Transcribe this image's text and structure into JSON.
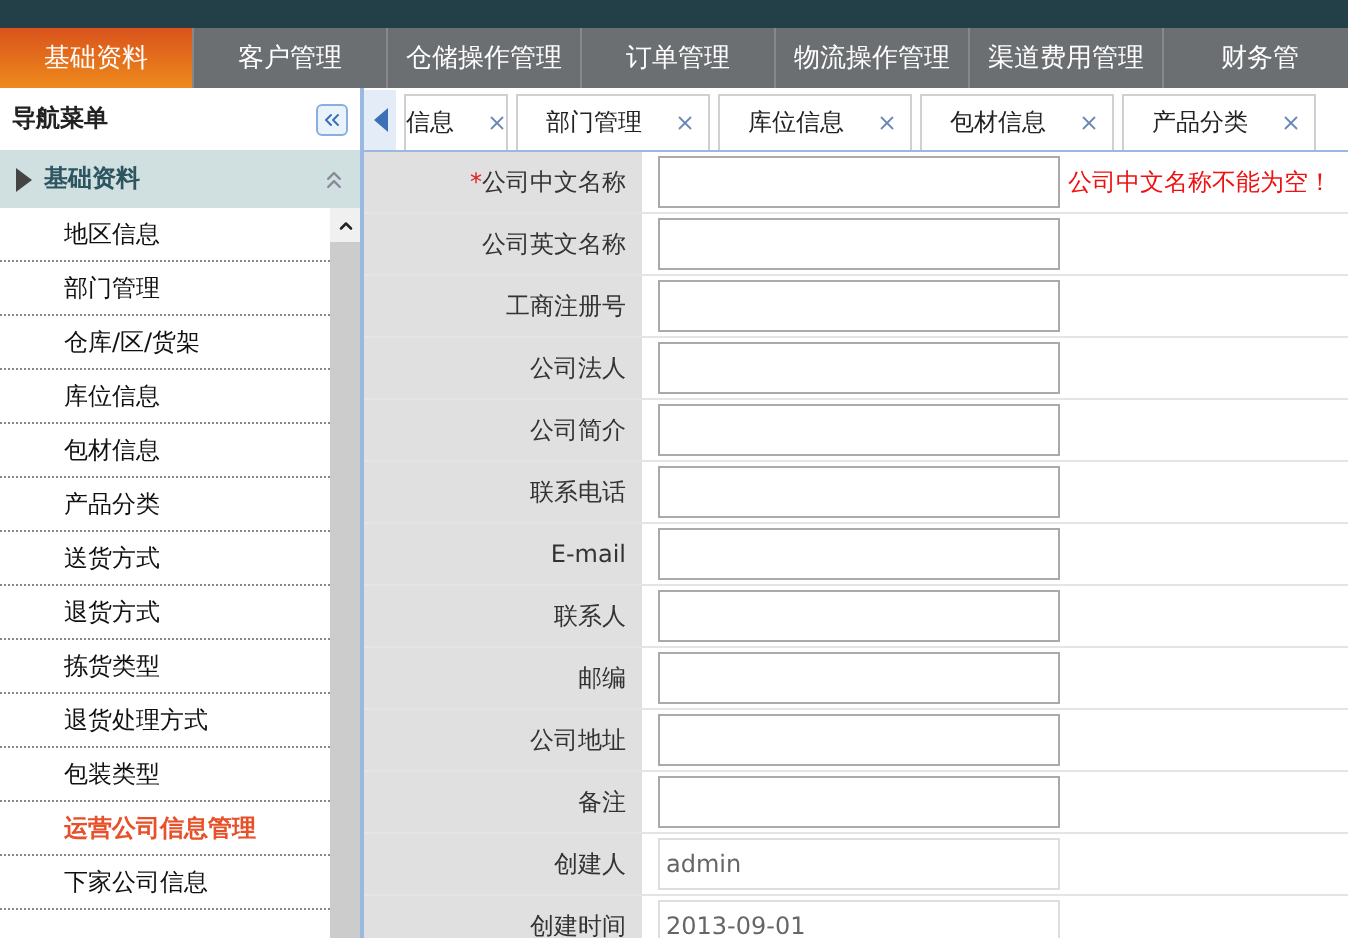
{
  "main_menu": [
    {
      "label": "基础资料",
      "selected": true
    },
    {
      "label": "客户管理",
      "selected": false
    },
    {
      "label": "仓储操作管理",
      "selected": false
    },
    {
      "label": "订单管理",
      "selected": false
    },
    {
      "label": "物流操作管理",
      "selected": false
    },
    {
      "label": "渠道费用管理",
      "selected": false
    },
    {
      "label": "财务管",
      "selected": false
    }
  ],
  "sidebar": {
    "title": "导航菜单",
    "section": "基础资料",
    "items": [
      {
        "label": "地区信息",
        "selected": false
      },
      {
        "label": "部门管理",
        "selected": false
      },
      {
        "label": "仓库/区/货架",
        "selected": false
      },
      {
        "label": "库位信息",
        "selected": false
      },
      {
        "label": "包材信息",
        "selected": false
      },
      {
        "label": "产品分类",
        "selected": false
      },
      {
        "label": "送货方式",
        "selected": false
      },
      {
        "label": "退货方式",
        "selected": false
      },
      {
        "label": "拣货类型",
        "selected": false
      },
      {
        "label": "退货处理方式",
        "selected": false
      },
      {
        "label": "包装类型",
        "selected": false
      },
      {
        "label": "运营公司信息管理",
        "selected": true
      },
      {
        "label": "下家公司信息",
        "selected": false
      }
    ]
  },
  "page_tabs": [
    {
      "label": "信息"
    },
    {
      "label": "部门管理"
    },
    {
      "label": "库位信息"
    },
    {
      "label": "包材信息"
    },
    {
      "label": "产品分类"
    }
  ],
  "form": [
    {
      "label": "公司中文名称",
      "required_mark": "*",
      "error": "公司中文名称不能为空！"
    },
    {
      "label": "公司英文名称"
    },
    {
      "label": "工商注册号"
    },
    {
      "label": "公司法人"
    },
    {
      "label": "公司简介"
    },
    {
      "label": "联系电话"
    },
    {
      "label": "E-mail"
    },
    {
      "label": "联系人"
    },
    {
      "label": "邮编"
    },
    {
      "label": "公司地址"
    },
    {
      "label": "备注"
    },
    {
      "label": "创建人",
      "value": "admin",
      "readonly": true
    },
    {
      "label": "创建时间",
      "value": "2013-09-01",
      "readonly": true
    }
  ]
}
